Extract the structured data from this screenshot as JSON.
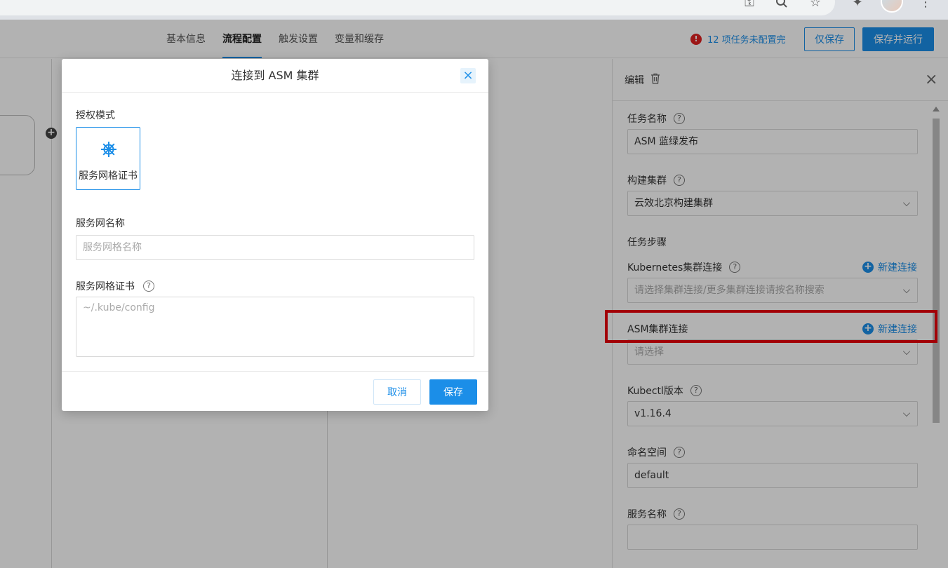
{
  "browser": {
    "url_fragment": "edit",
    "icons": [
      "key-icon",
      "search-icon",
      "star-icon",
      "extension-icon",
      "menu-icon"
    ]
  },
  "header": {
    "tabs": [
      {
        "label": "基本信息",
        "active": false
      },
      {
        "label": "流程配置",
        "active": true
      },
      {
        "label": "触发设置",
        "active": false
      },
      {
        "label": "变量和缓存",
        "active": false
      }
    ],
    "warning_text": "12 项任务未配置完",
    "warning_icon": "!",
    "save_only_label": "仅保存",
    "save_run_label": "保存并运行"
  },
  "panel": {
    "title": "编辑",
    "fields": {
      "task_name": {
        "label": "任务名称",
        "value": "ASM 蓝绿发布"
      },
      "build_cluster": {
        "label": "构建集群",
        "value": "云效北京构建集群"
      },
      "task_steps": {
        "label": "任务步骤"
      },
      "k8s_conn": {
        "label": "Kubernetes集群连接",
        "placeholder": "请选择集群连接/更多集群连接请按名称搜索",
        "new_link": "新建连接"
      },
      "asm_conn": {
        "label": "ASM集群连接",
        "placeholder": "请选择",
        "new_link": "新建连接"
      },
      "kubectl": {
        "label": "Kubectl版本",
        "value": "v1.16.4"
      },
      "namespace": {
        "label": "命名空间",
        "value": "default"
      },
      "service_name": {
        "label": "服务名称",
        "value": ""
      }
    },
    "help_glyph": "?",
    "close_glyph": "×"
  },
  "dialog": {
    "title": "连接到 ASM 集群",
    "close_glyph": "×",
    "auth_mode_label": "授权模式",
    "auth_option": "服务网格证书",
    "mesh_name_label": "服务网名称",
    "mesh_name_placeholder": "服务网格名称",
    "cert_label": "服务网格证书",
    "cert_placeholder": "~/.kube/config",
    "help_glyph": "?",
    "cancel_label": "取消",
    "save_label": "保存"
  },
  "colors": {
    "accent": "#1b8ee8",
    "warning": "#e02020",
    "highlight": "#e8000b"
  }
}
